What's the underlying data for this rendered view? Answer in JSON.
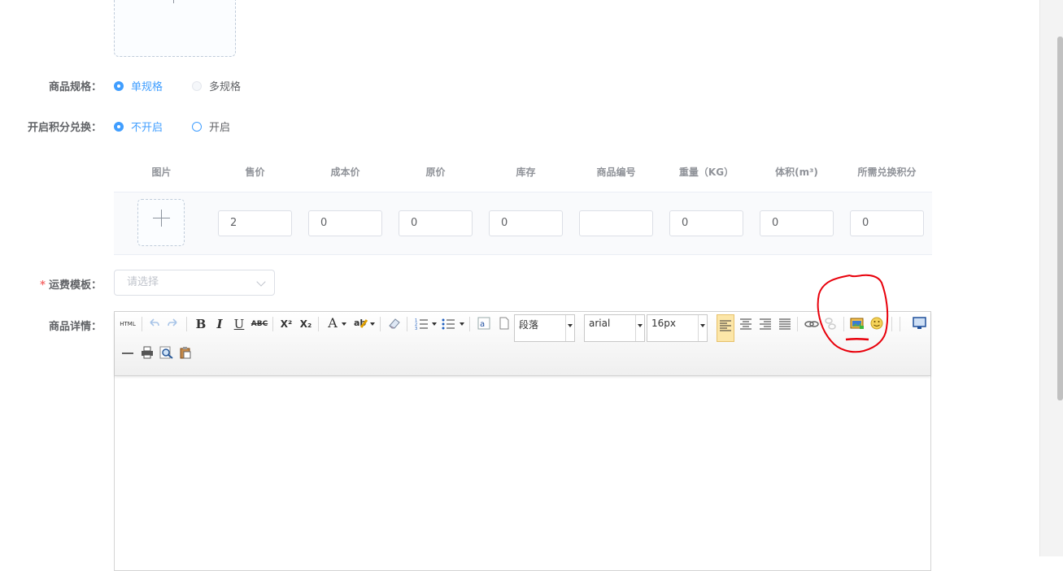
{
  "form": {
    "spec_label": "商品规格：",
    "spec_options": [
      "单规格",
      "多规格"
    ],
    "points_label": "开启积分兑换：",
    "points_options": [
      "不开启",
      "开启"
    ],
    "shipping_label": "运费模板：",
    "shipping_required_mark": "*",
    "shipping_placeholder": "请选择",
    "detail_label": "商品详情："
  },
  "sku_table": {
    "headers": [
      "图片",
      "售价",
      "成本价",
      "原价",
      "库存",
      "商品编号",
      "重量（KG）",
      "体积(m³)",
      "所需兑换积分"
    ],
    "row": {
      "price": "2",
      "cost": "0",
      "original": "0",
      "stock": "0",
      "code": "",
      "weight": "0",
      "volume": "0",
      "points": "0"
    }
  },
  "editor": {
    "html_label": "HTML",
    "bold": "B",
    "italic": "I",
    "underline": "U",
    "strike": "ABC",
    "superscript": "X²",
    "subscript": "X₂",
    "fontcolor": "A",
    "paragraph": "段落",
    "fontfamily": "arial",
    "fontsize": "16px"
  },
  "colors": {
    "primary": "#409eff",
    "annotation": "#e8000b"
  }
}
